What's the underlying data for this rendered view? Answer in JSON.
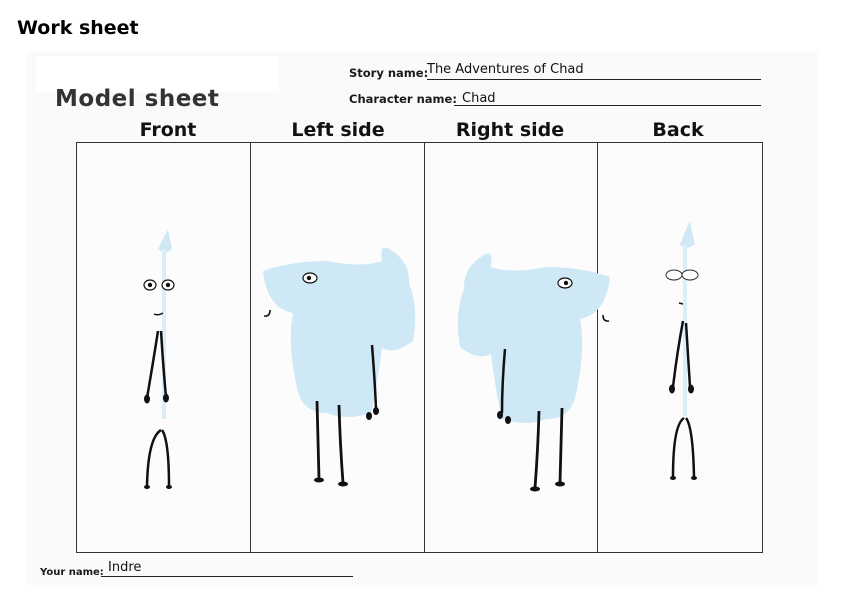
{
  "page_heading": "Work sheet",
  "sheet": {
    "title": "Model sheet",
    "story_label": "Story name:",
    "story_value": "The Adventures of Chad",
    "character_label": "Character name:",
    "character_value": "Chad",
    "views": [
      "Front",
      "Left side",
      "Right side",
      "Back"
    ],
    "your_name_label": "Your name:",
    "your_name_value": "Indre"
  },
  "colors": {
    "body_fill": "#cfe8f5",
    "limb": "#111111",
    "frame": "#333333"
  }
}
